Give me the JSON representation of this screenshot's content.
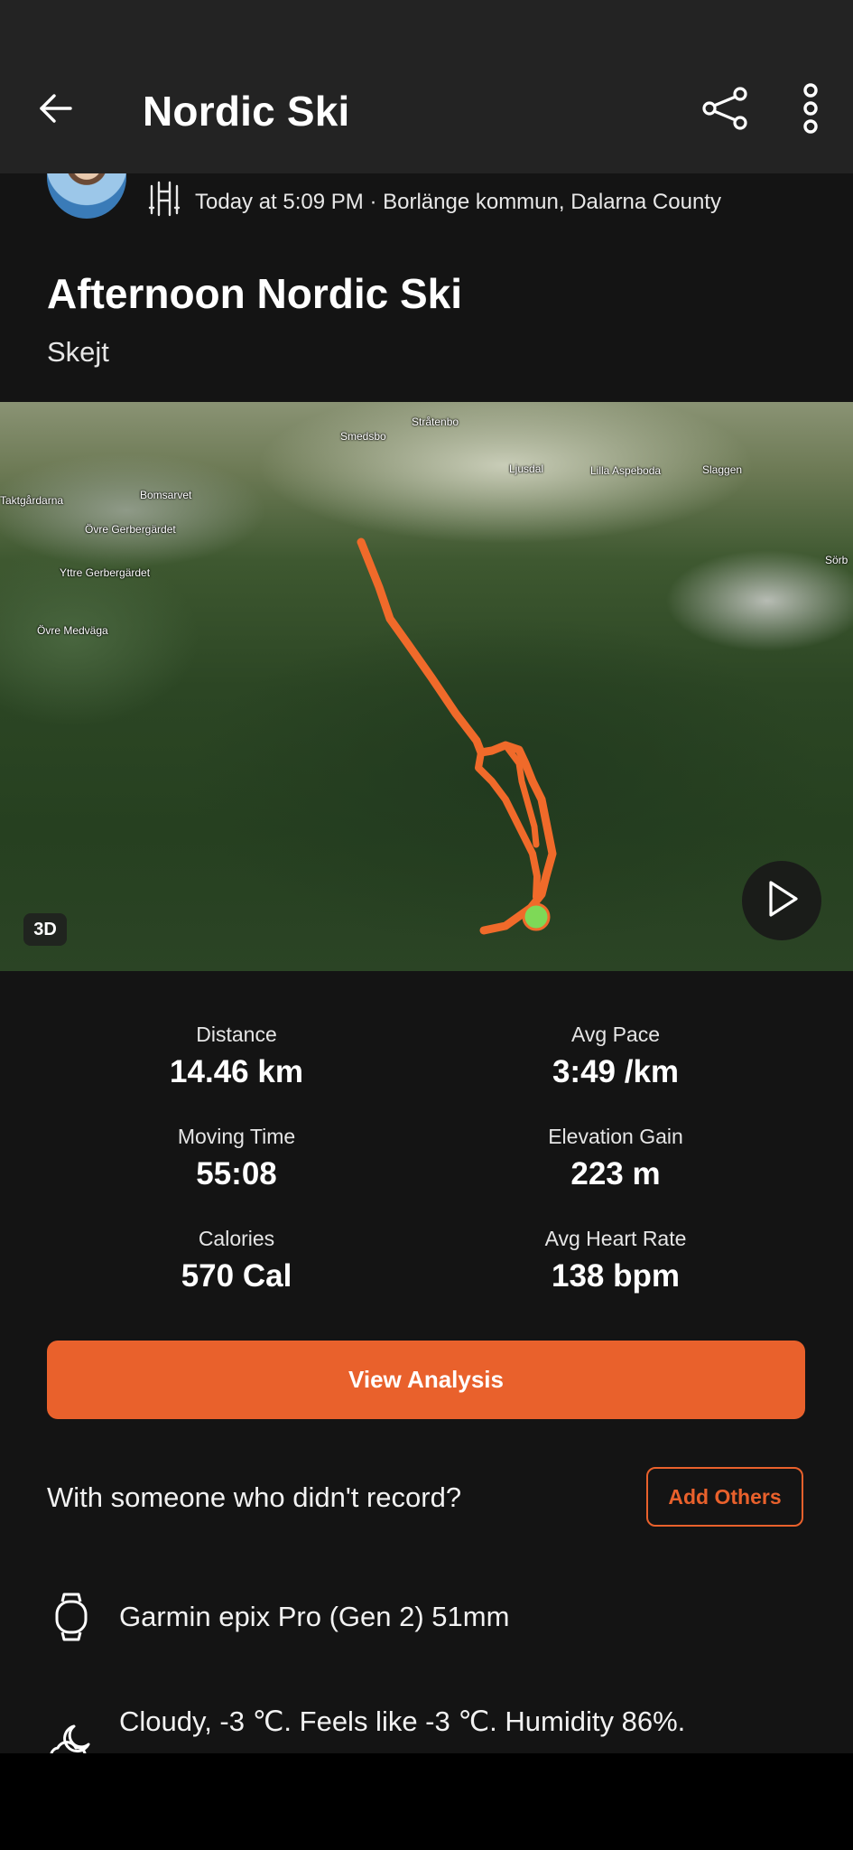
{
  "appbar": {
    "title": "Nordic Ski"
  },
  "meta": {
    "timestamp_location": "Today at 5:09 PM · Borlänge kommun, Dalarna County"
  },
  "activity": {
    "title": "Afternoon Nordic Ski",
    "subtitle": "Skejt"
  },
  "map": {
    "badge": "3D",
    "labels": [
      "Stråtenbo",
      "Smedsbo",
      "Ljusdal",
      "Lilla Aspeboda",
      "Slaggen",
      "Sörb",
      "Taktgårdarna",
      "Bomsarvet",
      "Övre Gerbergärdet",
      "Yttre Gerbergärdet",
      "Övre Medväga"
    ],
    "route_color": "#f06a2a",
    "start_marker_color": "#7ed957"
  },
  "stats": [
    {
      "label": "Distance",
      "value": "14.46 km"
    },
    {
      "label": "Avg Pace",
      "value": "3:49 /km"
    },
    {
      "label": "Moving Time",
      "value": "55:08"
    },
    {
      "label": "Elevation Gain",
      "value": "223 m"
    },
    {
      "label": "Calories",
      "value": "570 Cal"
    },
    {
      "label": "Avg Heart Rate",
      "value": "138 bpm"
    }
  ],
  "actions": {
    "view_analysis": "View Analysis",
    "with_someone": "With someone who didn't record?",
    "add_others": "Add Others"
  },
  "device": {
    "name": "Garmin epix Pro (Gen 2) 51mm",
    "icon": "watch-icon"
  },
  "weather": {
    "text": "Cloudy, -3 ℃. Feels like -3 ℃. Humidity 86%.",
    "icon": "cloud-moon-icon"
  },
  "colors": {
    "accent": "#e9612c",
    "background": "#141414",
    "appbar": "#232323"
  }
}
